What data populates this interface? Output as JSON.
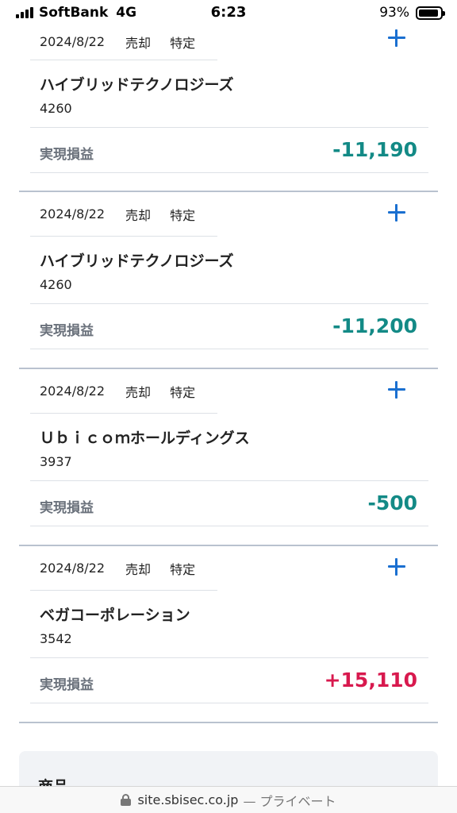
{
  "status_bar": {
    "carrier": "SoftBank",
    "network": "4G",
    "time": "6:23",
    "battery_percent": "93%",
    "battery_level": 0.93
  },
  "trades": [
    {
      "date": "2024/8/22",
      "type": "売却",
      "account": "特定",
      "name": "ハイブリッドテクノロジーズ",
      "code": "4260",
      "pl_label": "実現損益",
      "pl_value": "-11,190",
      "pl_sign": "negative"
    },
    {
      "date": "2024/8/22",
      "type": "売却",
      "account": "特定",
      "name": "ハイブリッドテクノロジーズ",
      "code": "4260",
      "pl_label": "実現損益",
      "pl_value": "-11,200",
      "pl_sign": "negative"
    },
    {
      "date": "2024/8/22",
      "type": "売却",
      "account": "特定",
      "name": "Ｕｂｉｃｏｍホールディングス",
      "code": "3937",
      "pl_label": "実現損益",
      "pl_value": "-500",
      "pl_sign": "negative"
    },
    {
      "date": "2024/8/22",
      "type": "売却",
      "account": "特定",
      "name": "ベガコーポレーション",
      "code": "3542",
      "pl_label": "実現損益",
      "pl_value": "+15,110",
      "pl_sign": "positive"
    }
  ],
  "product_panel": {
    "title": "商品"
  },
  "url_bar": {
    "domain": "site.sbisec.co.jp",
    "suffix": "— プライベート"
  },
  "colors": {
    "negative": "#138a86",
    "positive": "#d8194e",
    "accent": "#1a6fd0"
  },
  "icons": {
    "expand": "plus-icon",
    "secure": "lock-icon"
  }
}
